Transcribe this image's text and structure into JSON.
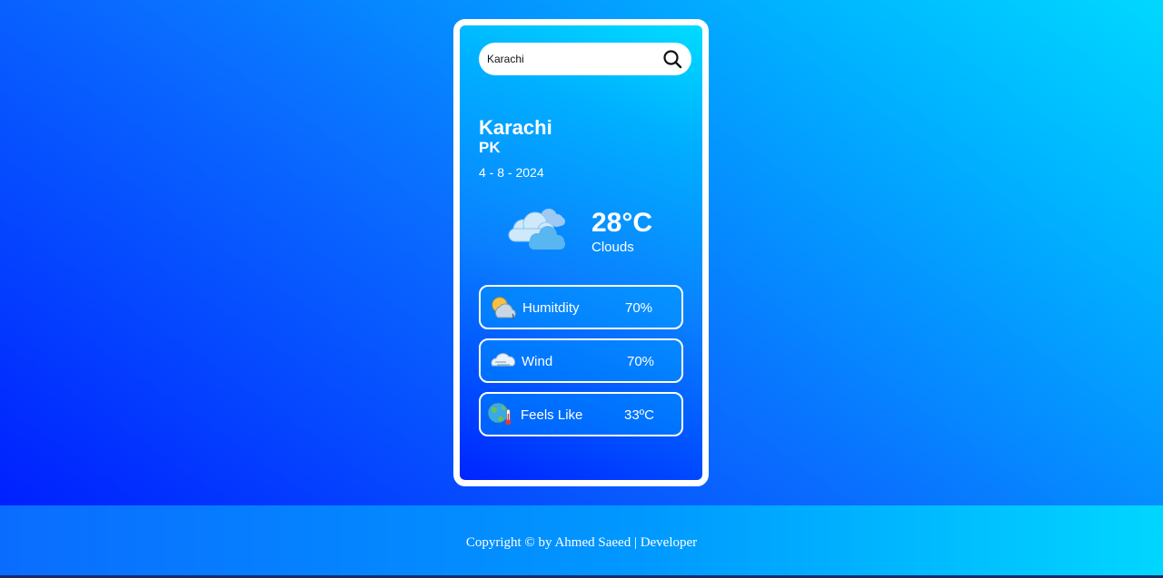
{
  "search": {
    "value": "Karachi",
    "placeholder": ""
  },
  "location": {
    "city": "Karachi",
    "country": "PK",
    "date": "4 - 8 - 2024"
  },
  "current": {
    "temperature": "28°C",
    "condition": "Clouds",
    "icon": "clouds-icon"
  },
  "stats": [
    {
      "label": "Humitdity",
      "value": "70%",
      "icon": "humidity-sun-cloud-icon"
    },
    {
      "label": "Wind",
      "value": "70%",
      "icon": "wind-cloud-icon"
    },
    {
      "label": "Feels Like",
      "value": "33ºC",
      "icon": "globe-thermometer-icon"
    }
  ],
  "footer": {
    "text": "Copyright © by Ahmed Saeed | Developer"
  },
  "colors": {
    "card_border": "#ffffff",
    "gradient_start": "#0020ff",
    "gradient_end": "#00d8ff"
  }
}
